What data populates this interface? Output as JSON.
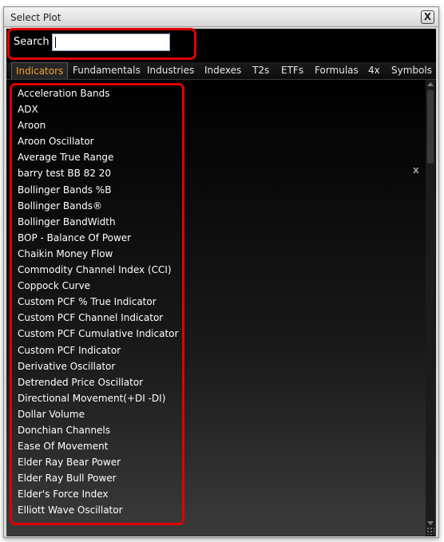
{
  "window": {
    "title": "Select Plot",
    "close_label": "X"
  },
  "search": {
    "label": "Search",
    "value": "",
    "placeholder": ""
  },
  "tabs": [
    {
      "label": "Indicators",
      "active": true
    },
    {
      "label": "Fundamentals",
      "active": false
    },
    {
      "label": "Industries",
      "active": false
    },
    {
      "label": "Indexes",
      "active": false
    },
    {
      "label": "T2s",
      "active": false
    },
    {
      "label": "ETFs",
      "active": false
    },
    {
      "label": "Formulas",
      "active": false
    },
    {
      "label": "4x",
      "active": false
    },
    {
      "label": "Symbols",
      "active": false
    }
  ],
  "indicators": [
    "Acceleration Bands",
    "ADX",
    "Aroon",
    "Aroon Oscillator",
    "Average True Range",
    "barry test BB 82 20",
    "Bollinger Bands %B",
    "Bollinger Bands®",
    "Bollinger BandWidth",
    "BOP - Balance Of Power",
    "Chaikin Money Flow",
    "Commodity Channel Index (CCI)",
    "Coppock Curve",
    "Custom PCF % True Indicator",
    "Custom PCF Channel Indicator",
    "Custom PCF Cumulative Indicator",
    "Custom PCF Indicator",
    "Derivative Oscillator",
    "Detrended Price Oscillator",
    "Directional Movement(+DI -DI)",
    "Dollar Volume",
    "Donchian Channels",
    "Ease Of Movement",
    "Elder Ray Bear Power",
    "Elder Ray Bull Power",
    "Elder's Force Index",
    "Elliott Wave Oscillator"
  ],
  "delete_label": "x",
  "colors": {
    "active_tab": "#f0a030",
    "highlight": "#e00000",
    "panel_bg": "#000000"
  },
  "icons": {
    "close": "close-icon",
    "scroll_up": "arrow-up-icon",
    "scroll_down": "arrow-down-icon",
    "resize": "resize-grip-icon"
  }
}
